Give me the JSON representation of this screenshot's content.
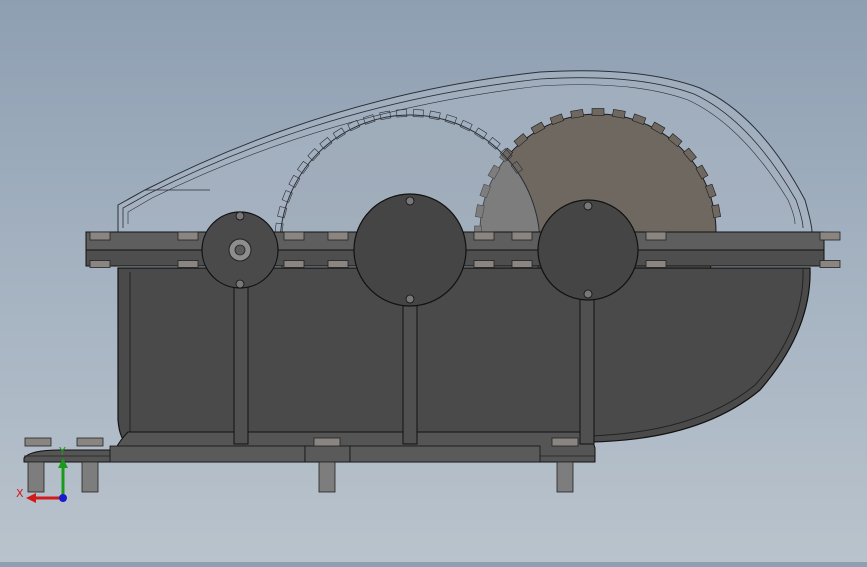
{
  "viewport": {
    "background_top": "#8e9fb2",
    "background_bottom": "#b9c3cc"
  },
  "model": {
    "housing_color": "#4a4a4a",
    "housing_edge": "#111111",
    "cover_color": "#a9b4c2",
    "large_gear_color": "#6f6861",
    "bolt_color": "#8a8580",
    "shaft_count": 3,
    "gear_count": 2
  },
  "triad": {
    "x_label": "X",
    "y_label": "Y",
    "x_color": "#d11a1a",
    "y_color": "#1a9a1a",
    "z_color": "#1a1acc"
  }
}
